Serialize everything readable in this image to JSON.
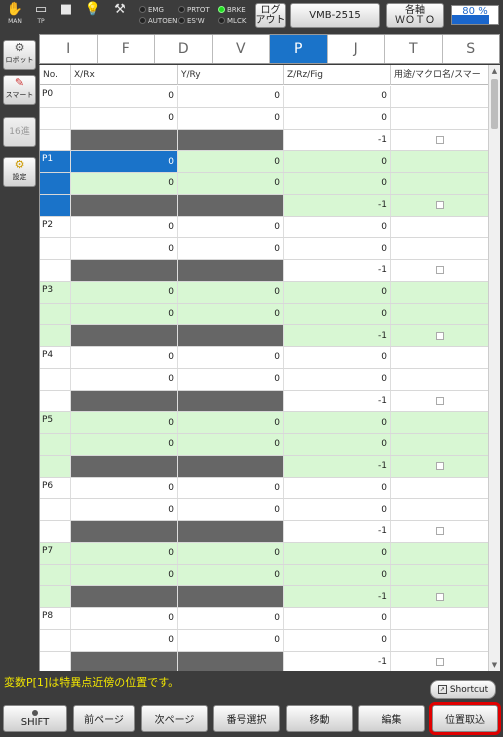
{
  "topbar": {
    "icons": [
      {
        "name": "hand-icon",
        "glyph": "✋",
        "caption": "MAN"
      },
      {
        "name": "teach-pendant-icon",
        "glyph": "▭",
        "caption": "TP"
      },
      {
        "name": "stop-square-icon",
        "glyph": "■",
        "caption": ""
      },
      {
        "name": "lightbulb-icon",
        "glyph": "💡",
        "caption": ""
      },
      {
        "name": "wrench-icon",
        "glyph": "⚒",
        "caption": ""
      }
    ],
    "lamps_left": [
      "EMG",
      "AUTOEN"
    ],
    "lamps_mid": [
      "PRTOT",
      "ES'W"
    ],
    "lamps_right": [
      "BRKE",
      "MLCK"
    ],
    "logout_label": "ログ\nアウト",
    "robot_model": "VMB-2515",
    "axis_label": "各軸\nＷＯＴＯ",
    "speed_label": "80 %",
    "speed_value": 80
  },
  "side": {
    "robot_label": "ロボット",
    "smart_label": "スマート",
    "radix_label": "16進",
    "settings_label": "設定"
  },
  "tabs": [
    "I",
    "F",
    "D",
    "V",
    "P",
    "J",
    "T",
    "S"
  ],
  "active_tab": "P",
  "table": {
    "headers": [
      "No.",
      "X/Rx",
      "Y/Ry",
      "Z/Rz/Fig",
      "用途/マクロ名/スマー"
    ],
    "points": [
      {
        "no": "P0",
        "x": "0",
        "y": "0",
        "z": "0",
        "x2": "0",
        "y2": "0",
        "z2": "0",
        "fig": "-1"
      },
      {
        "no": "P1",
        "x": "0",
        "y": "0",
        "z": "0",
        "x2": "0",
        "y2": "0",
        "z2": "0",
        "fig": "-1"
      },
      {
        "no": "P2",
        "x": "0",
        "y": "0",
        "z": "0",
        "x2": "0",
        "y2": "0",
        "z2": "0",
        "fig": "-1"
      },
      {
        "no": "P3",
        "x": "0",
        "y": "0",
        "z": "0",
        "x2": "0",
        "y2": "0",
        "z2": "0",
        "fig": "-1"
      },
      {
        "no": "P4",
        "x": "0",
        "y": "0",
        "z": "0",
        "x2": "0",
        "y2": "0",
        "z2": "0",
        "fig": "-1"
      },
      {
        "no": "P5",
        "x": "0",
        "y": "0",
        "z": "0",
        "x2": "0",
        "y2": "0",
        "z2": "0",
        "fig": "-1"
      },
      {
        "no": "P6",
        "x": "0",
        "y": "0",
        "z": "0",
        "x2": "0",
        "y2": "0",
        "z2": "0",
        "fig": "-1"
      },
      {
        "no": "P7",
        "x": "0",
        "y": "0",
        "z": "0",
        "x2": "0",
        "y2": "0",
        "z2": "0",
        "fig": "-1"
      },
      {
        "no": "P8",
        "x": "0",
        "y": "0",
        "z": "0",
        "x2": "0",
        "y2": "0",
        "z2": "0",
        "fig": "-1"
      }
    ],
    "selected_point": "P1"
  },
  "status_text": "変数P[1]は特異点近傍の位置です。",
  "shortcut_label": "Shortcut",
  "fkeys": {
    "shift": "SHIFT",
    "prev_page": "前ページ",
    "next_page": "次ページ",
    "number_select": "番号選択",
    "move": "移動",
    "edit": "編集",
    "capture_position": "位置取込"
  },
  "colors": {
    "accent_blue": "#1a73c9",
    "row_green": "#d8f7d3",
    "status_yellow": "#f2e600",
    "highlight_red": "#e00000"
  }
}
